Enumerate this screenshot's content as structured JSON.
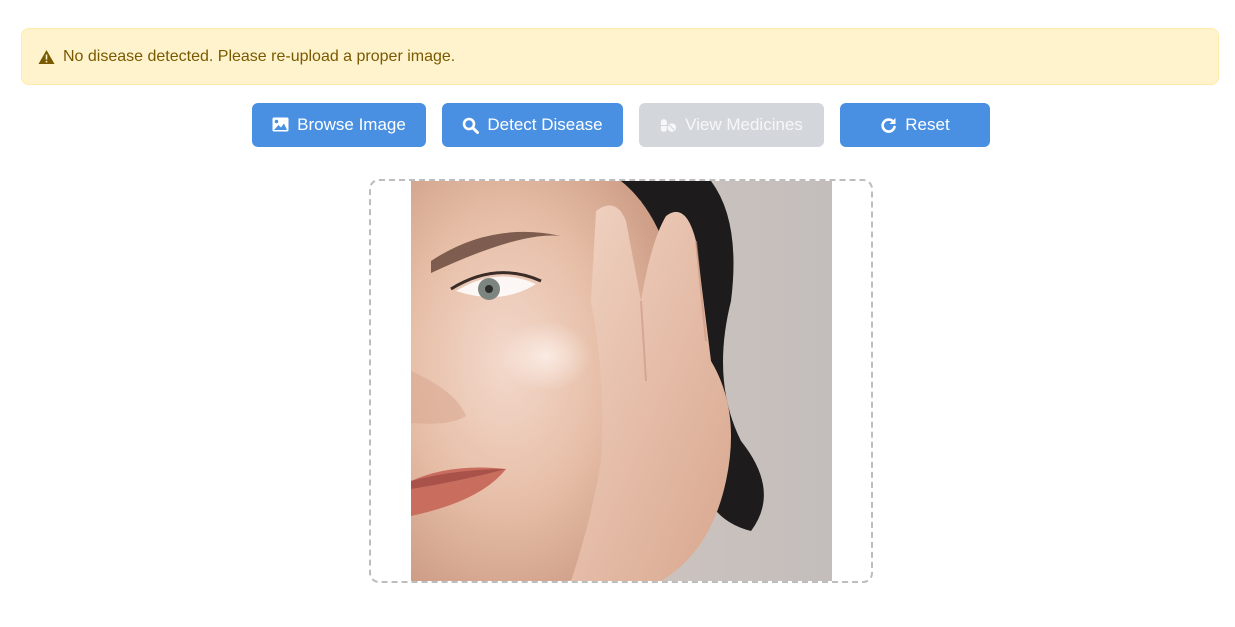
{
  "alert": {
    "message": "No disease detected. Please re-upload a proper image.",
    "icon": "warning-triangle-icon",
    "colors": {
      "background": "#fff3cd",
      "text": "#7a5a00"
    }
  },
  "buttons": {
    "browse": {
      "label": "Browse Image",
      "icon": "image-icon"
    },
    "detect": {
      "label": "Detect Disease",
      "icon": "search-icon"
    },
    "medicines": {
      "label": "View Medicines",
      "icon": "pills-icon",
      "disabled": true
    },
    "reset": {
      "label": "Reset",
      "icon": "redo-icon"
    }
  },
  "colors": {
    "primary": "#4a90e2",
    "disabled": "#d3d6da"
  },
  "upload": {
    "preview": "face-with-hand-photo"
  }
}
